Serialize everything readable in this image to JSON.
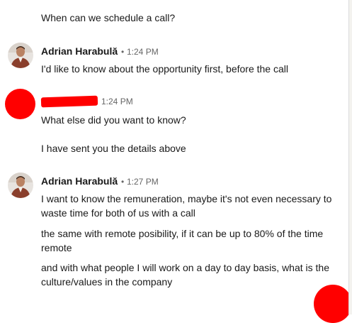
{
  "messages": {
    "m0": {
      "text": "When can we schedule a call?"
    },
    "group1": {
      "sender": "Adrian Harabulă",
      "separator": "•",
      "time": "1:24 PM",
      "lines": [
        "I'd like to know about the opportunity first, before the call"
      ]
    },
    "group2": {
      "sender": "",
      "time": "1:24 PM",
      "lines": [
        "What else did you want to know?",
        "I have sent you the details above"
      ]
    },
    "group3": {
      "sender": "Adrian Harabulă",
      "separator": "•",
      "time": "1:27 PM",
      "lines": [
        "I want to know the remuneration, maybe it's not even necessary to waste time for both of us with a call",
        "the same with remote posibility, if it can be up to 80% of the time remote",
        "and with what people I will work on a day to day basis, what is the culture/values in the company"
      ]
    }
  },
  "colors": {
    "redaction": "#ff0000",
    "text": "#191919",
    "muted": "#666666"
  },
  "icons": {
    "avatar": "profile-photo",
    "redacted_avatar": "red-redaction-circle"
  }
}
